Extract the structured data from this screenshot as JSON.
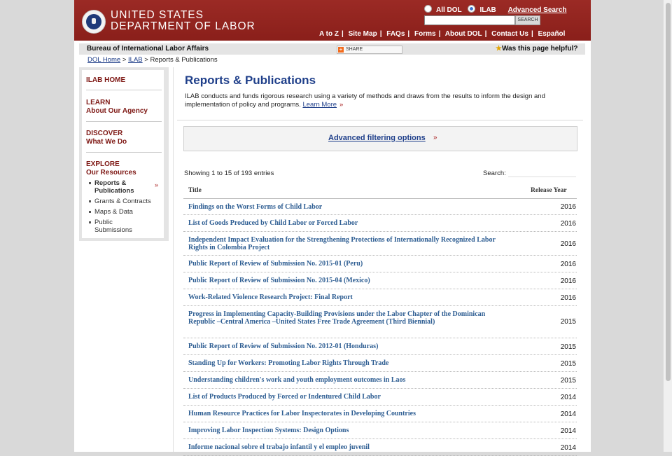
{
  "header": {
    "agency_line1": "UNITED STATES",
    "agency_line2": "DEPARTMENT OF LABOR",
    "radio_all": "All DOL",
    "radio_ilab": "ILAB",
    "advanced_search": "Advanced Search",
    "search_button": "SEARCH",
    "nav": [
      "A to Z",
      "Site Map",
      "FAQs",
      "Forms",
      "About DOL",
      "Contact Us",
      "Español"
    ]
  },
  "bureau": {
    "title": "Bureau of International Labor Affairs",
    "share": "SHARE",
    "helpful": "Was this page helpful?"
  },
  "breadcrumb": {
    "home": "DOL Home",
    "ilab": "ILAB",
    "current": "Reports & Publications",
    "sep": ">"
  },
  "sidebar": {
    "ilab_home": "ILAB HOME",
    "learn_1": "LEARN",
    "learn_2": "About Our Agency",
    "discover_1": "DISCOVER",
    "discover_2": "What We Do",
    "explore_1": "EXPLORE",
    "explore_2": "Our Resources",
    "items": [
      "Reports & Publications",
      "Grants & Contracts",
      "Maps & Data",
      "Public Submissions"
    ],
    "active_arrow": "»"
  },
  "main": {
    "title": "Reports & Publications",
    "intro": "ILAB conducts and funds rigorous research using a variety of methods and draws from the results to inform the design and implementation of policy and programs.",
    "learn_more": "Learn More",
    "arrow": "»",
    "filter_link": "Advanced filtering options",
    "entries_info": "Showing 1 to 15 of 193 entries",
    "search_label": "Search:",
    "col_title": "Title",
    "col_year": "Release Year",
    "rows": [
      {
        "title": "Findings on the Worst Forms of Child Labor",
        "year": "2016"
      },
      {
        "title": "List of Goods Produced by Child Labor or Forced Labor",
        "year": "2016"
      },
      {
        "title": "Independent Impact Evaluation for the Strengthening Protections of Internationally Recognized Labor Rights in Colombia Project",
        "year": "2016"
      },
      {
        "title": "Public Report of Review of Submission No. 2015-01 (Peru)",
        "year": "2016"
      },
      {
        "title": "Public Report of Review of Submission No. 2015-04 (Mexico)",
        "year": "2016"
      },
      {
        "title": "Work-Related Violence Research Project: Final Report",
        "year": "2016"
      },
      {
        "title": "Progress in Implementing Capacity-Building Provisions under the Labor Chapter of the Dominican Republic –Central America –United States Free Trade Agreement (Third Biennial)",
        "year": "2015"
      },
      {
        "title": "Public Report of Review of Submission No. 2012-01 (Honduras)",
        "year": "2015"
      },
      {
        "title": "Standing Up for Workers: Promoting Labor Rights Through Trade",
        "year": "2015"
      },
      {
        "title": "Understanding children's work and youth employment outcomes in Laos",
        "year": "2015"
      },
      {
        "title": "List of Products Produced by Forced or Indentured Child Labor",
        "year": "2014"
      },
      {
        "title": "Human Resource Practices for Labor Inspectorates in Developing Countries",
        "year": "2014"
      },
      {
        "title": "Improving Labor Inspection Systems: Design Options",
        "year": "2014"
      },
      {
        "title": "Informe nacional sobre el trabajo infantil y el empleo juvenil",
        "year": "2014"
      }
    ]
  }
}
